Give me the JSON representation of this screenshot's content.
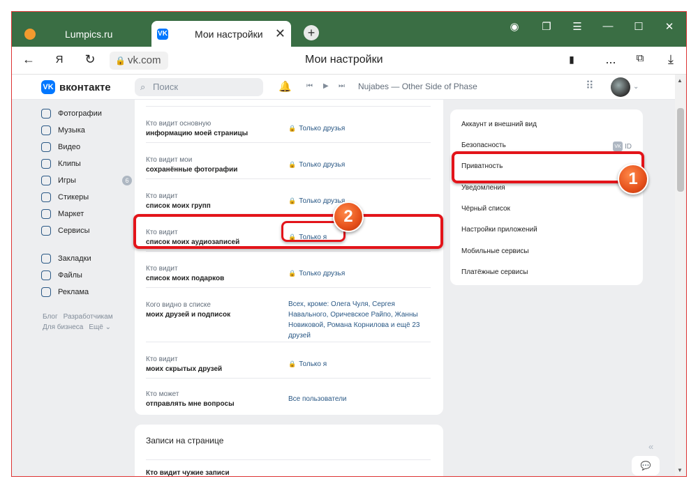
{
  "browser": {
    "tabs": [
      {
        "label": "Lumpics.ru"
      },
      {
        "label": "Мои настройки",
        "close": "✕"
      }
    ],
    "new_tab": "+",
    "url": "vk.com",
    "page_title": "Мои настройки",
    "more": "..."
  },
  "vk": {
    "logo_text": "вконтакте",
    "logo_mark": "VK",
    "search_placeholder": "Поиск",
    "now_playing": "Nujabes — Other Side of Phase"
  },
  "leftnav": {
    "items": [
      {
        "label": "Фотографии",
        "icon": "photo-icon"
      },
      {
        "label": "Музыка",
        "icon": "music-icon"
      },
      {
        "label": "Видео",
        "icon": "video-icon"
      },
      {
        "label": "Клипы",
        "icon": "clips-icon"
      },
      {
        "label": "Игры",
        "icon": "games-icon",
        "badge": "6"
      },
      {
        "label": "Стикеры",
        "icon": "stickers-icon"
      },
      {
        "label": "Маркет",
        "icon": "market-icon"
      },
      {
        "label": "Сервисы",
        "icon": "services-icon"
      },
      {
        "label": "Закладки",
        "icon": "bookmarks-icon"
      },
      {
        "label": "Файлы",
        "icon": "files-icon"
      },
      {
        "label": "Реклама",
        "icon": "ads-icon"
      }
    ],
    "footer": [
      "Блог",
      "Разработчикам",
      "Для бизнеса",
      "Ещё ⌄"
    ]
  },
  "privacy": {
    "rows": [
      {
        "q1": "Кто видит основную",
        "q2": "информацию моей страницы",
        "value": "Только друзья",
        "lock": true
      },
      {
        "q1": "Кто видит мои",
        "q2": "сохранённые фотографии",
        "value": "Только друзья",
        "lock": true
      },
      {
        "q1": "Кто видит",
        "q2": "список моих групп",
        "value": "Только друзья",
        "lock": true
      },
      {
        "q1": "Кто видит",
        "q2": "список моих аудиозаписей",
        "value": "Только я",
        "lock": true
      },
      {
        "q1": "Кто видит",
        "q2": "список моих подарков",
        "value": "Только друзья",
        "lock": true
      },
      {
        "q1": "Кого видно в списке",
        "q2": "моих друзей и подписок",
        "value": "Всех, кроме: Олега Чуля, Сергея Навального, Оричевское Райпо, Жанны Новиковой, Романа Корнилова и ещё 23 друзей",
        "lock": false
      },
      {
        "q1": "Кто видит",
        "q2": "моих скрытых друзей",
        "value": "Только я",
        "lock": true
      },
      {
        "q1": "Кто может",
        "q2": "отправлять мне вопросы",
        "value": "Все пользователи",
        "lock": false
      }
    ],
    "section2_title": "Записи на странице",
    "section2_row": "Кто видит чужие записи"
  },
  "settings_menu": {
    "items": [
      "Аккаунт и внешний вид",
      "Безопасность",
      "Приватность",
      "Уведомления",
      "Чёрный список",
      "Настройки приложений",
      "Мобильные сервисы",
      "Платёжные сервисы"
    ],
    "id_label": "ID"
  },
  "annotations": {
    "one": "1",
    "two": "2"
  },
  "colors": {
    "accent": "#0077ff",
    "link": "#2a5885",
    "highlight": "#e3141a",
    "tabstrip": "#3a6e44"
  }
}
